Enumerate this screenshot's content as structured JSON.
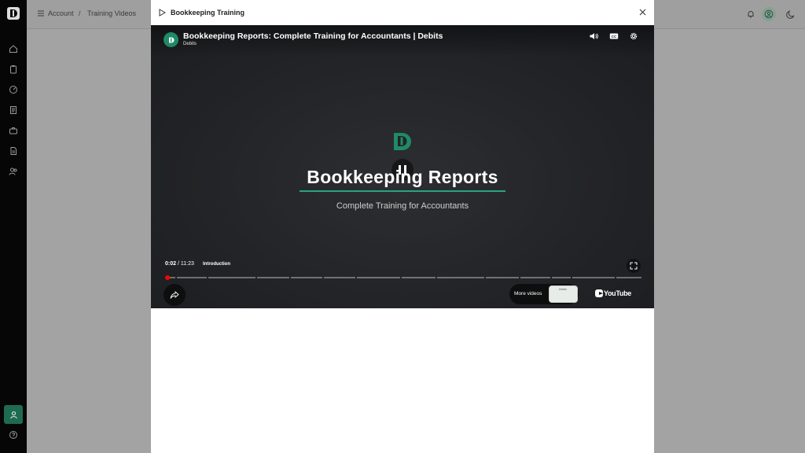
{
  "header": {
    "breadcrumb": [
      "Account",
      "Training Videos"
    ],
    "breadcrumb_separator": "/"
  },
  "sidebar": {
    "items": [
      {
        "icon": "home-icon"
      },
      {
        "icon": "clipboard-icon"
      },
      {
        "icon": "dashboard-icon"
      },
      {
        "icon": "document-icon"
      },
      {
        "icon": "briefcase-icon"
      },
      {
        "icon": "report-icon"
      },
      {
        "icon": "users-icon"
      }
    ],
    "bottom": [
      {
        "icon": "user-icon",
        "active": true
      },
      {
        "icon": "help-icon"
      }
    ]
  },
  "modal": {
    "title": "Bookkeeping Training",
    "video": {
      "title": "Bookkeeping Reports: Complete Training for Accountants | Debits",
      "channel": "Debits",
      "heading": "Bookkeeping Reports",
      "subheading": "Complete Training for Accountants",
      "current_time": "0:02",
      "duration": "11:23",
      "time_separator": "/",
      "chapter": "Introduction",
      "progress": 0.003,
      "more_videos_label": "More videos",
      "thumb_text": "Debits",
      "youtube_label": "YouTube"
    }
  },
  "colors": {
    "brand": "#1f8a66",
    "accent_line": "#2aa37f",
    "progress": "#ff0000"
  }
}
